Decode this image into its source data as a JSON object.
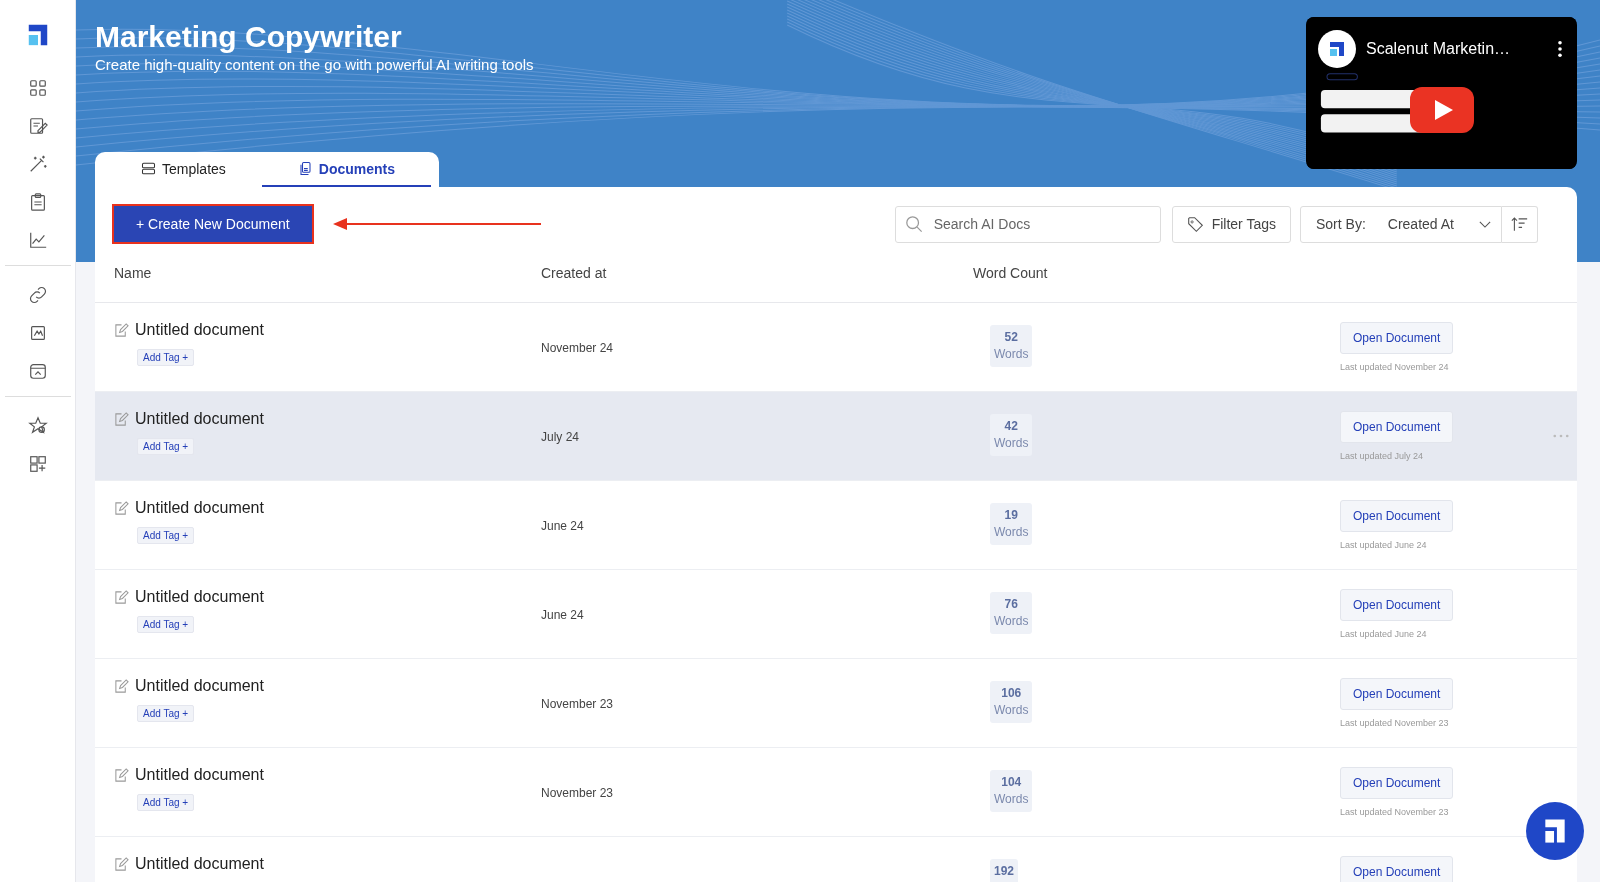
{
  "header": {
    "title": "Marketing Copywriter",
    "subtitle": "Create high-quality content on the go with powerful AI writing tools"
  },
  "video": {
    "kind": "picture",
    "channel_title": "Scalenut Marketin…"
  },
  "tabs": [
    {
      "label": "Templates",
      "selected": false
    },
    {
      "label": "Documents",
      "selected": true
    }
  ],
  "create_button": "+ Create New Document",
  "search": {
    "placeholder": "Search AI Docs"
  },
  "filter_button": "Filter Tags",
  "sort": {
    "label": "Sort By:",
    "value": "Created At"
  },
  "table": {
    "columns": [
      "Name",
      "Created at",
      "Word Count"
    ],
    "rows": [
      {
        "name": "Untitled document",
        "tag_button": "Add Tag +",
        "created": "November 24",
        "count": "52",
        "count_unit": "Words",
        "open_button": "Open Document",
        "updated": "Last updated November 24",
        "highlighted": false
      },
      {
        "name": "Untitled document",
        "tag_button": "Add Tag +",
        "created": "July 24",
        "count": "42",
        "count_unit": "Words",
        "open_button": "Open Document",
        "updated": "Last updated July 24",
        "highlighted": true
      },
      {
        "name": "Untitled document",
        "tag_button": "Add Tag +",
        "created": "June 24",
        "count": "19",
        "count_unit": "Words",
        "open_button": "Open Document",
        "updated": "Last updated June 24",
        "highlighted": false
      },
      {
        "name": "Untitled document",
        "tag_button": "Add Tag +",
        "created": "June 24",
        "count": "76",
        "count_unit": "Words",
        "open_button": "Open Document",
        "updated": "Last updated June 24",
        "highlighted": false
      },
      {
        "name": "Untitled document",
        "tag_button": "Add Tag +",
        "created": "November 23",
        "count": "106",
        "count_unit": "Words",
        "open_button": "Open Document",
        "updated": "Last updated November 23",
        "highlighted": false
      },
      {
        "name": "Untitled document",
        "tag_button": "Add Tag +",
        "created": "November 23",
        "count": "104",
        "count_unit": "Words",
        "open_button": "Open Document",
        "updated": "Last updated November 23",
        "highlighted": false
      },
      {
        "name": "Untitled document",
        "count": "192",
        "open_button": "Open Document",
        "highlighted": false
      }
    ]
  }
}
